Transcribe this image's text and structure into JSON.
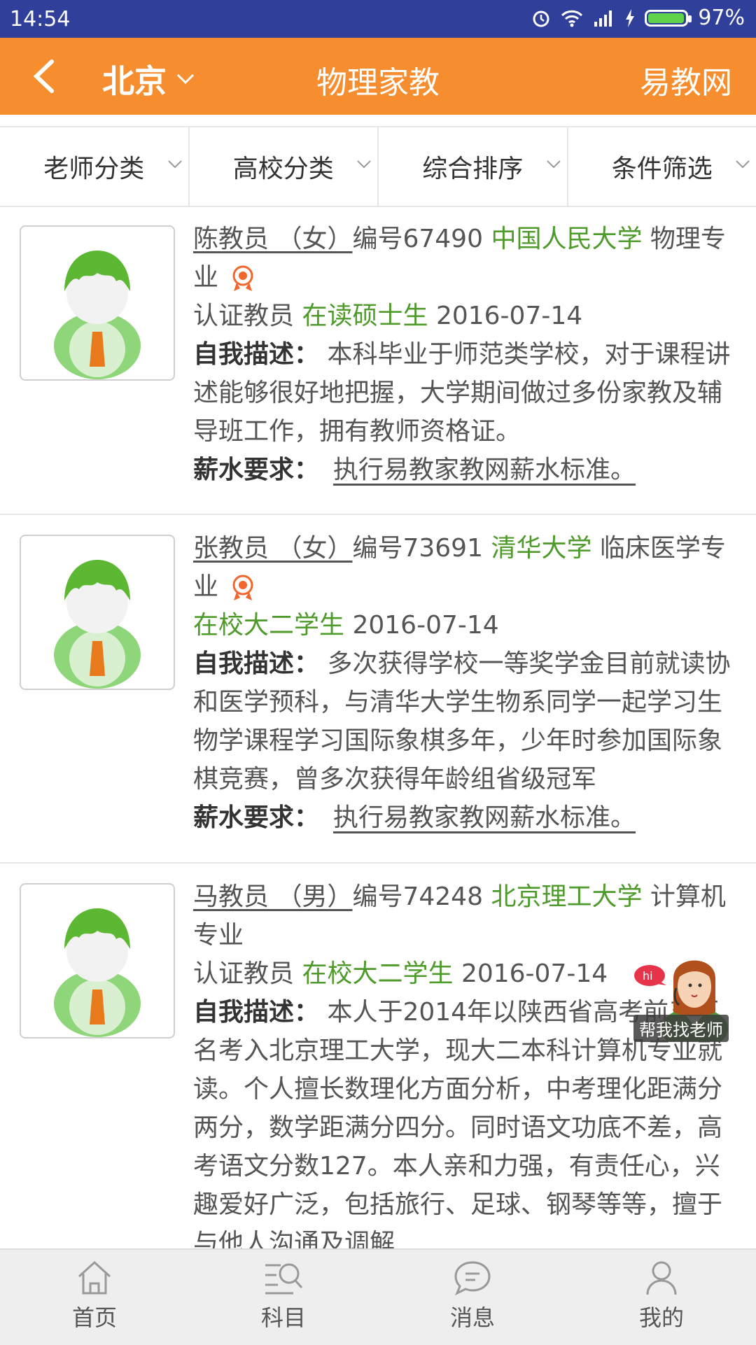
{
  "status": {
    "time": "14:54",
    "battery": "97%"
  },
  "header": {
    "city": "北京",
    "title": "物理家教",
    "brand": "易教网"
  },
  "filters": [
    "老师分类",
    "高校分类",
    "综合排序",
    "条件筛选"
  ],
  "labels": {
    "desc": "自我描述：",
    "salary": "薪水要求："
  },
  "teachers": [
    {
      "name": "陈教员 （女）",
      "id_text": "编号67490",
      "school": "中国人民大学",
      "major": "物理专业",
      "verified": "认证教员",
      "degree": "在读硕士生",
      "date": "2016-07-14",
      "desc": "本科毕业于师范类学校，对于课程讲述能够很好地把握，大学期间做过多份家教及辅导班工作，拥有教师资格证。",
      "salary": "执行易教家教网薪水标准。"
    },
    {
      "name": "张教员 （女）",
      "id_text": "编号73691",
      "school": "清华大学",
      "major": "临床医学专业",
      "verified": "",
      "degree": "在校大二学生",
      "date": "2016-07-14",
      "desc": "多次获得学校一等奖学金目前就读协和医学预科，与清华大学生物系同学一起学习生物学课程学习国际象棋多年，少年时参加国际象棋竞赛，曾多次获得年龄组省级冠军",
      "salary": "执行易教家教网薪水标准。"
    },
    {
      "name": "马教员 （男）",
      "id_text": "编号74248",
      "school": "北京理工大学",
      "major": "计算机专业",
      "verified": "认证教员",
      "degree": "在校大二学生",
      "date": "2016-07-14",
      "desc": "本人于2014年以陕西省高考前五百名考入北京理工大学，现大二本科计算机专业就读。个人擅长数理化方面分析，中考理化距满分两分，数学距满分四分。同时语文功底不差，高考语文分数127。本人亲和力强，有责任心，兴趣爱好广泛，包括旅行、足球、钢琴等等，擅于与他人沟通及调解",
      "salary": ""
    }
  ],
  "helper": {
    "bubble": "hi",
    "label": "帮我找老师"
  },
  "nav": [
    "首页",
    "科目",
    "消息",
    "我的"
  ],
  "colors": {
    "header": "#f68d2e",
    "statusbar": "#2f3f9a",
    "green": "#4e9a2a"
  }
}
